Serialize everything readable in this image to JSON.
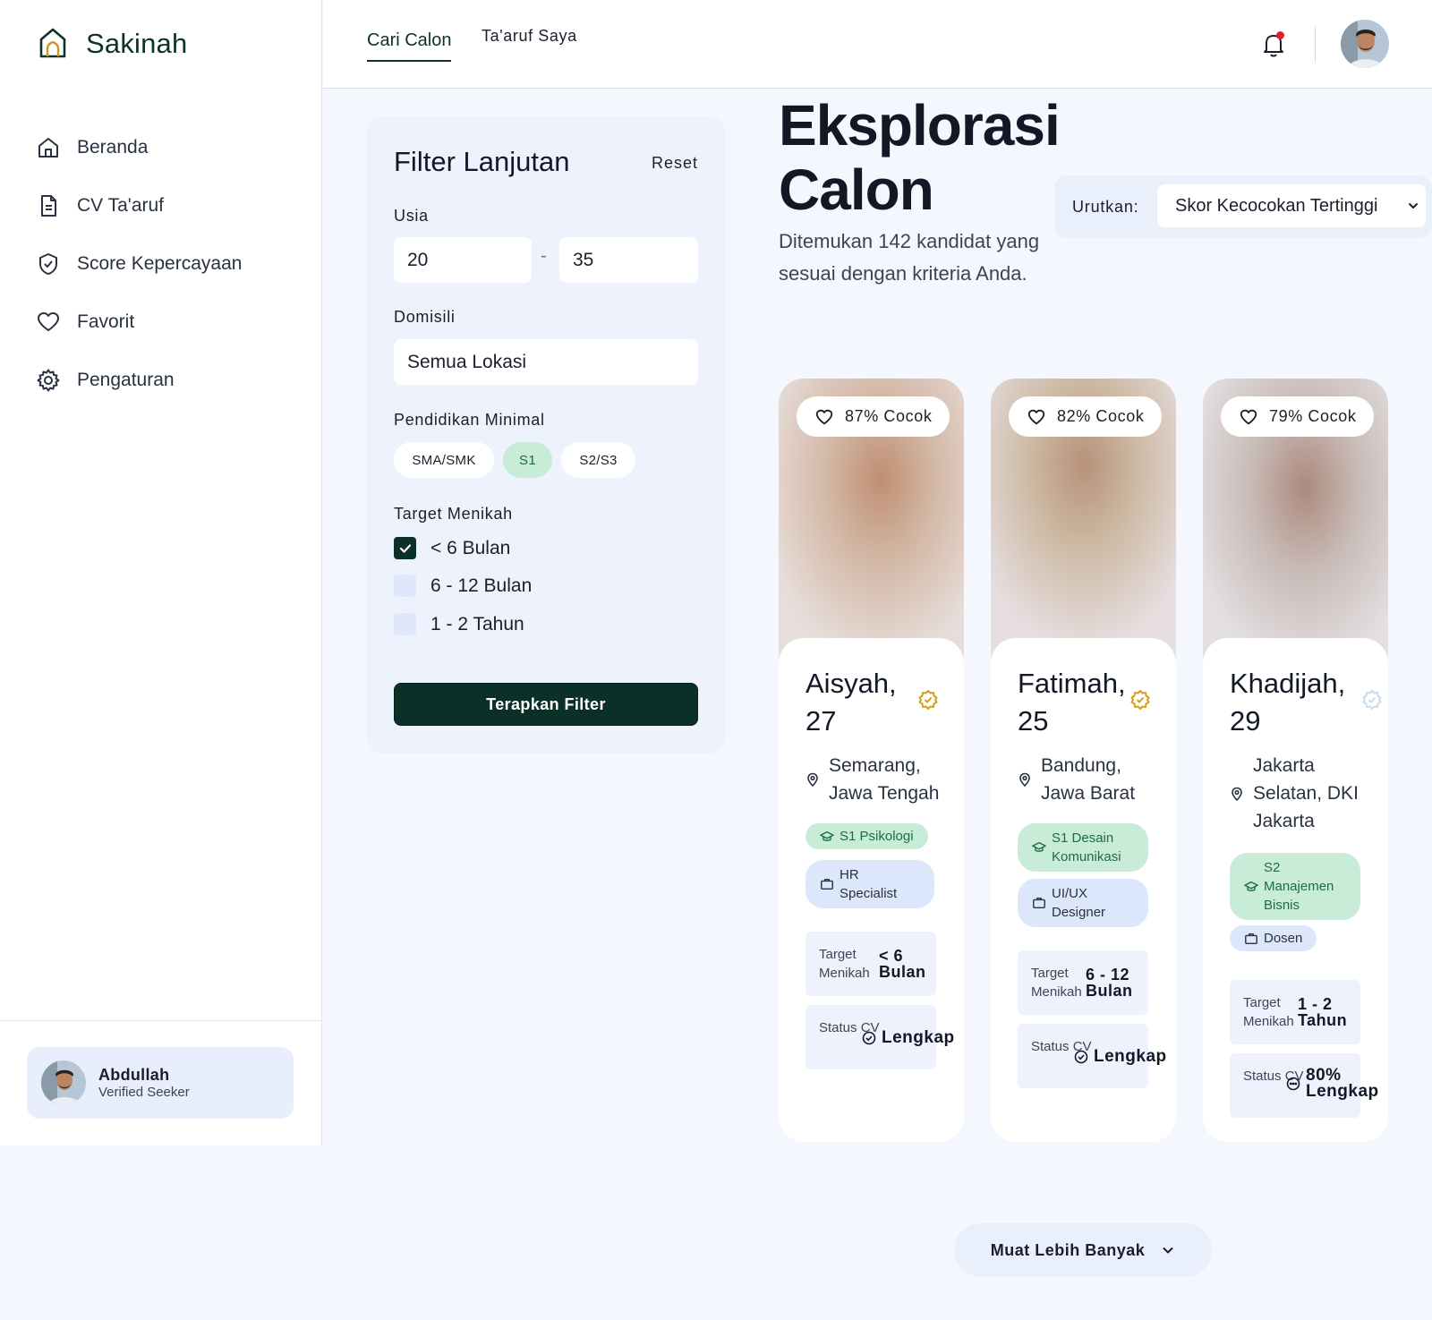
{
  "brand": {
    "name": "Sakinah",
    "color": "#0d3328"
  },
  "nav": [
    {
      "label": "Beranda",
      "icon": "home-icon"
    },
    {
      "label": "CV Ta'aruf",
      "icon": "document-icon"
    },
    {
      "label": "Score Kepercayaan",
      "icon": "shield-check-icon"
    },
    {
      "label": "Favorit",
      "icon": "heart-icon"
    },
    {
      "label": "Pengaturan",
      "icon": "gear-icon"
    }
  ],
  "user": {
    "name": "Abdullah",
    "role": "Verified Seeker"
  },
  "tabs": [
    {
      "label": "Cari Calon",
      "active": true
    },
    {
      "label": "Ta'aruf Saya",
      "active": false
    }
  ],
  "filter": {
    "title": "Filter Lanjutan",
    "reset": "Reset",
    "age_label": "Usia",
    "age_min": "20",
    "age_sep": "-",
    "age_max": "35",
    "domicile_label": "Domisili",
    "domicile_value": "Semua Lokasi",
    "edu_label": "Pendidikan Minimal",
    "edu_options": [
      {
        "label": "SMA/SMK",
        "selected": false
      },
      {
        "label": "S1",
        "selected": true
      },
      {
        "label": "S2/S3",
        "selected": false
      }
    ],
    "target_label": "Target Menikah",
    "target_options": [
      {
        "label": "< 6 Bulan",
        "checked": true
      },
      {
        "label": "6 - 12 Bulan",
        "checked": false
      },
      {
        "label": "1 - 2 Tahun",
        "checked": false
      }
    ],
    "apply": "Terapkan Filter"
  },
  "main": {
    "title_line1": "Eksplorasi",
    "title_line2": "Calon",
    "subtitle": "Ditemukan 142 kandidat yang sesuai dengan kriteria Anda.",
    "sort_label": "Urutkan:",
    "sort_value": "Skor Kecocokan Tertinggi"
  },
  "cards": [
    {
      "match": "87% Cocok",
      "name": "Aisyah, 27",
      "verified": true,
      "location": "Semarang, Jawa Tengah",
      "education": "S1 Psikologi",
      "job": "HR Specialist",
      "target_key": "Target Menikah",
      "target_value_1": "< 6",
      "target_value_2": "Bulan",
      "status_key": "Status CV",
      "status_value_1": "Lengkap",
      "status_value_2": ""
    },
    {
      "match": "82% Cocok",
      "name": "Fatimah, 25",
      "verified": true,
      "location": "Bandung, Jawa Barat",
      "education": "S1 Desain Komunikasi",
      "job": "UI/UX Designer",
      "target_key": "Target Menikah",
      "target_value_1": "6 - 12",
      "target_value_2": "Bulan",
      "status_key": "Status CV",
      "status_value_1": "Lengkap",
      "status_value_2": ""
    },
    {
      "match": "79% Cocok",
      "name": "Khadijah, 29",
      "verified": false,
      "location": "Jakarta Selatan, DKI Jakarta",
      "education": "S2 Manajemen Bisnis",
      "job": "Dosen",
      "target_key": "Target Menikah",
      "target_value_1": "1 - 2",
      "target_value_2": "Tahun",
      "status_key": "Status CV",
      "status_value_1": "80%",
      "status_value_2": "Lengkap"
    }
  ],
  "load_more": "Muat Lebih Banyak",
  "colors": {
    "accent": "#0b3027",
    "verified": "#d4a017",
    "edu_pill": "#c8ecd8",
    "notification": "#e11d2e"
  }
}
